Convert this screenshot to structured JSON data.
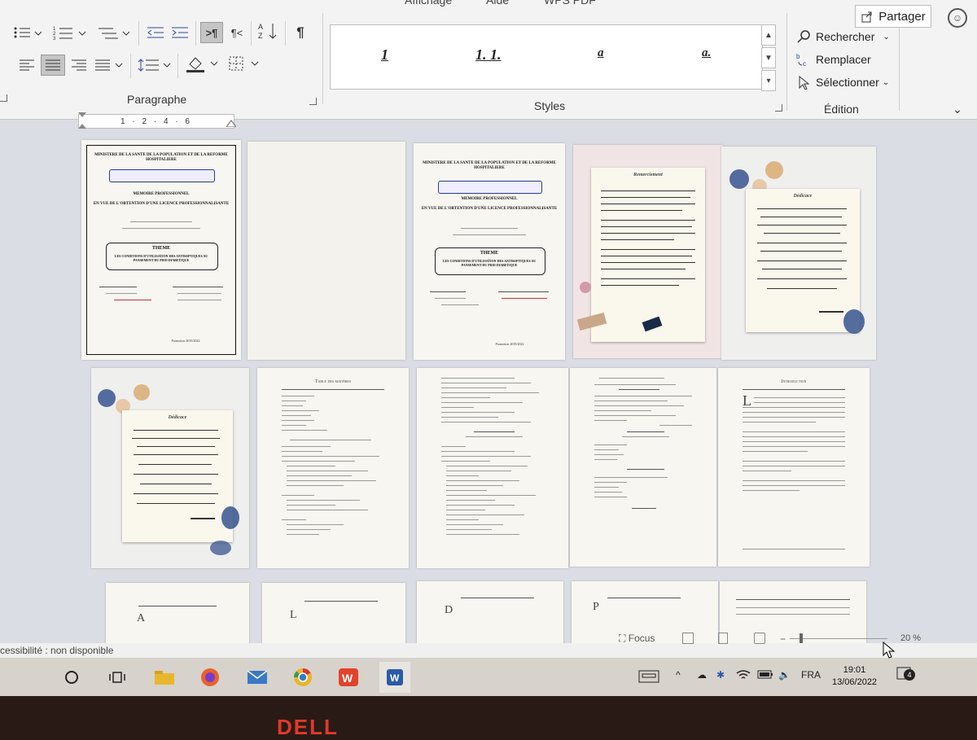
{
  "ribbon": {
    "top_tabs": [
      "Affichage",
      "Aide",
      "WPS PDF"
    ],
    "share_label": "Partager",
    "paragraph_label": "Paragraphe",
    "styles_label": "Styles",
    "editing_label": "Édition",
    "editing": {
      "find": "Rechercher",
      "replace": "Remplacer",
      "select": "Sélectionner"
    },
    "styles_gallery": [
      "1",
      "1.  1.",
      "a",
      "a."
    ]
  },
  "ruler": {
    "text": "1 · 2 · 4 · 6"
  },
  "pages": {
    "cover": {
      "ministry": "MINISTERE DE LA SANTE DE LA POPULATION ET DE LA REFORME HOSPITALIERE",
      "memoire": "MEMOIRE PROFESSIONNEL",
      "licence": "EN VUE DE L'OBTENTION D'UNE LICENCE PROFESSIONNALISANTE",
      "theme_title": "THEME",
      "theme_body": "LES CONDITIONS D'UTILISATION DES ANTISEPTIQUES AU PANSEMENT DU PIED DIABETIQUE",
      "promo": "Promotion 2019/2022"
    },
    "remerciement_title": "Remerciement",
    "dedicace_title": "Dédicace",
    "toc_title": "Table des matières",
    "introduction_title": "Introduction",
    "dropcaps": [
      "L",
      "A",
      "L",
      "D",
      "P"
    ]
  },
  "status": {
    "accessibility": "cessibilité : non disponible",
    "focus": "Focus",
    "zoom": "20 %"
  },
  "taskbar": {
    "language": "FRA",
    "time": "19:01",
    "date": "13/06/2022",
    "notifications": "4"
  },
  "bezel": {
    "logo": "DELL"
  }
}
